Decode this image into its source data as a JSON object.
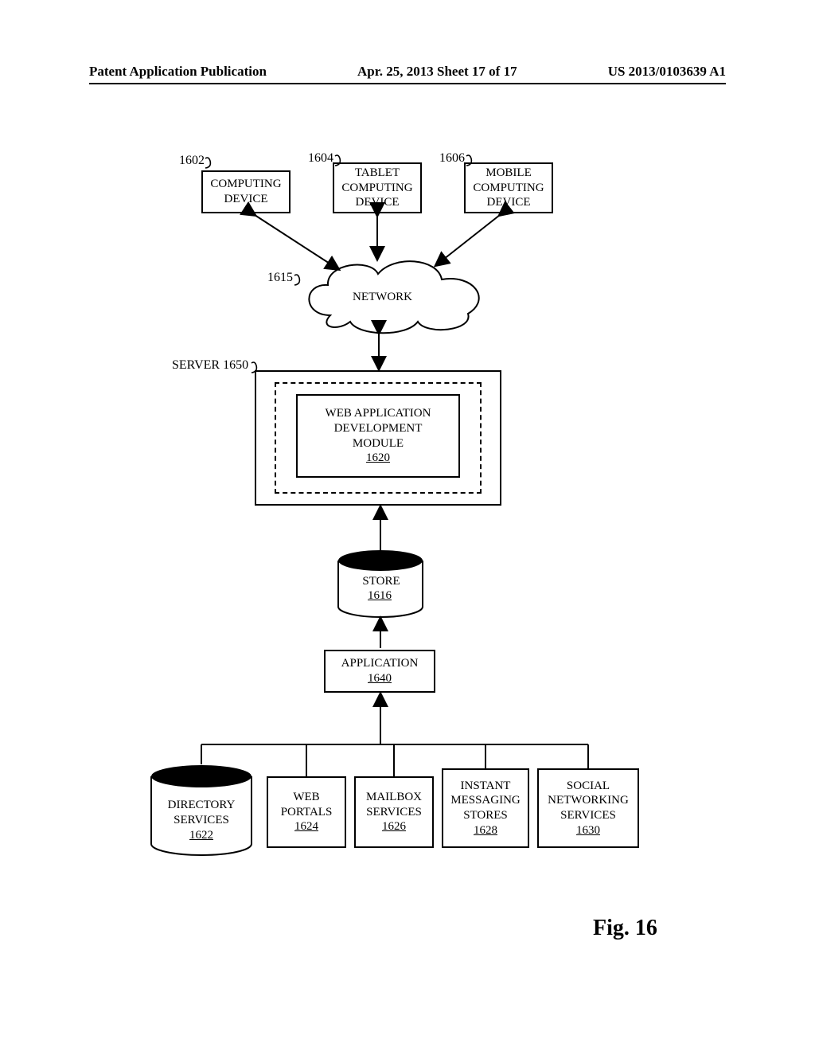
{
  "header": {
    "left": "Patent Application Publication",
    "center": "Apr. 25, 2013  Sheet 17 of 17",
    "right": "US 2013/0103639 A1"
  },
  "refs": {
    "r1602": "1602",
    "r1604": "1604",
    "r1606": "1606",
    "r1615": "1615",
    "server": "SERVER 1650"
  },
  "boxes": {
    "computing": "COMPUTING DEVICE",
    "tablet": [
      "TABLET",
      "COMPUTING",
      "DEVICE"
    ],
    "mobile": [
      "MOBILE",
      "COMPUTING",
      "DEVICE"
    ],
    "network": "NETWORK",
    "webapp": [
      "WEB APPLICATION",
      "DEVELOPMENT",
      "MODULE"
    ],
    "webapp_num": "1620",
    "store": "STORE",
    "store_num": "1616",
    "application": "APPLICATION",
    "application_num": "1640",
    "directory": [
      "DIRECTORY",
      "SERVICES"
    ],
    "directory_num": "1622",
    "webportals": [
      "WEB",
      "PORTALS"
    ],
    "webportals_num": "1624",
    "mailbox": [
      "MAILBOX",
      "SERVICES"
    ],
    "mailbox_num": "1626",
    "instant": [
      "INSTANT",
      "MESSAGING",
      "STORES"
    ],
    "instant_num": "1628",
    "social": [
      "SOCIAL",
      "NETWORKING",
      "SERVICES"
    ],
    "social_num": "1630"
  },
  "figure": "Fig. 16"
}
